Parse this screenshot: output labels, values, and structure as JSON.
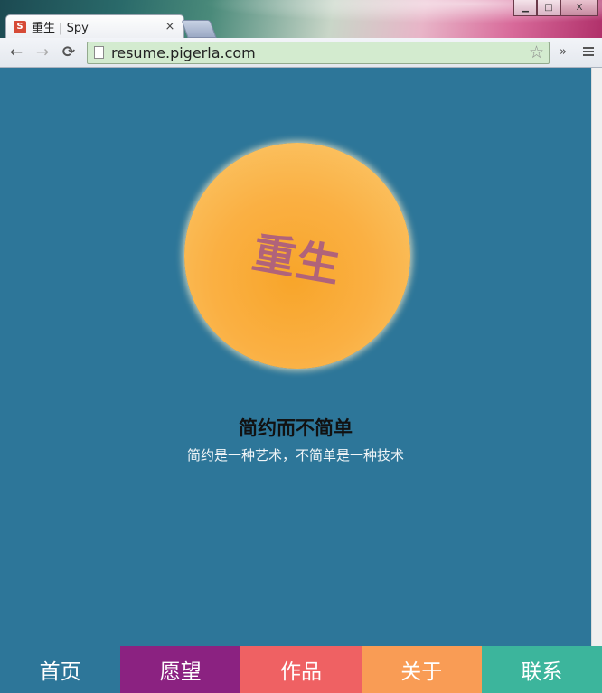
{
  "browser": {
    "tab_title": "重生 | Spy",
    "favicon_letter": "S",
    "close_symbol": "×",
    "url": "resume.pigerla.com",
    "back_icon": "←",
    "forward_icon": "→",
    "reload_icon": "⟳",
    "star_icon": "☆",
    "overflow_icon": "»",
    "window_buttons": {
      "minimize": "▁",
      "maximize": "□",
      "close": "X"
    }
  },
  "hero": {
    "orb_text": "重生",
    "title": "简约而不简单",
    "subtitle": "简约是一种艺术，不简单是一种技术"
  },
  "nav": {
    "items": [
      {
        "label": "首页",
        "color": "#2d7699"
      },
      {
        "label": "愿望",
        "color": "#8b2281"
      },
      {
        "label": "作品",
        "color": "#ef6163"
      },
      {
        "label": "关于",
        "color": "#f99c55"
      },
      {
        "label": "联系",
        "color": "#3cb59c"
      }
    ]
  }
}
